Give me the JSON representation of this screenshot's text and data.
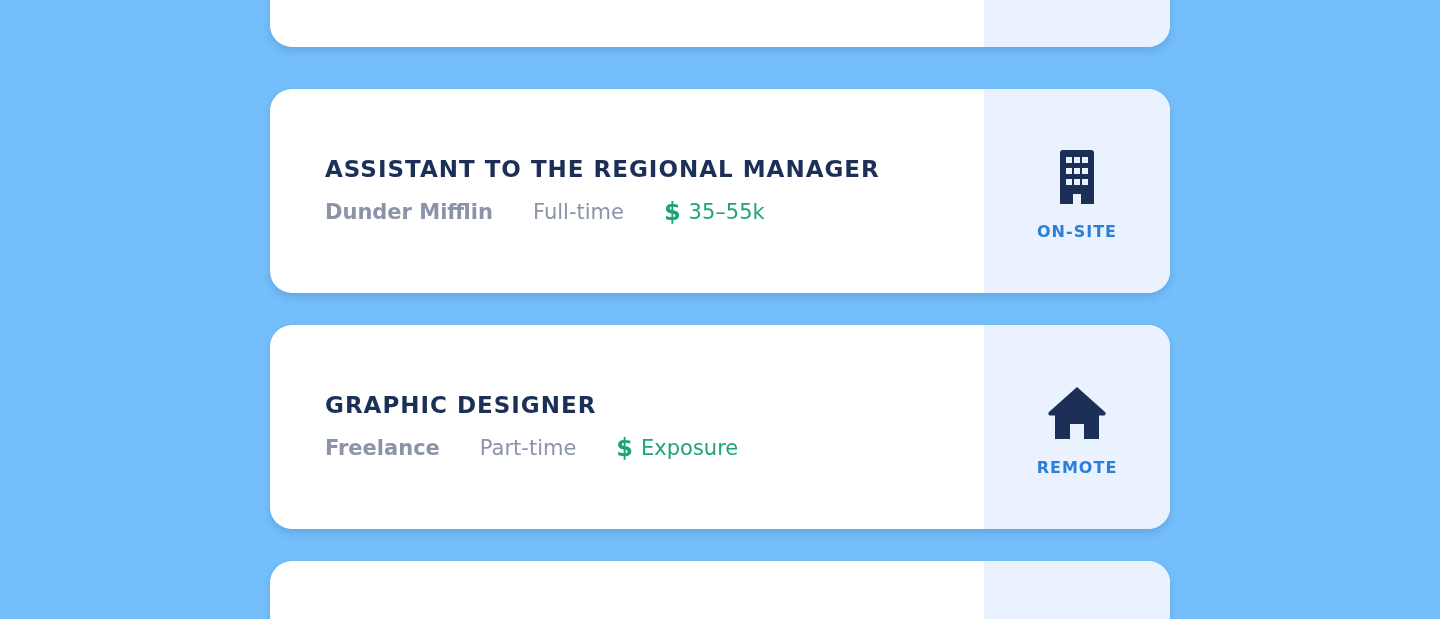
{
  "jobs": [
    {
      "title": "ASSISTANT TO THE REGIONAL MANAGER",
      "company": "Dunder Mifflin",
      "type": "Full-time",
      "salary_icon": "$",
      "salary": "35–55k",
      "work_mode": {
        "kind": "building",
        "label": "ON-SITE"
      }
    },
    {
      "title": "GRAPHIC DESIGNER",
      "company": "Freelance",
      "type": "Part-time",
      "salary_icon": "$",
      "salary": "Exposure",
      "work_mode": {
        "kind": "house",
        "label": "REMOTE"
      }
    }
  ]
}
